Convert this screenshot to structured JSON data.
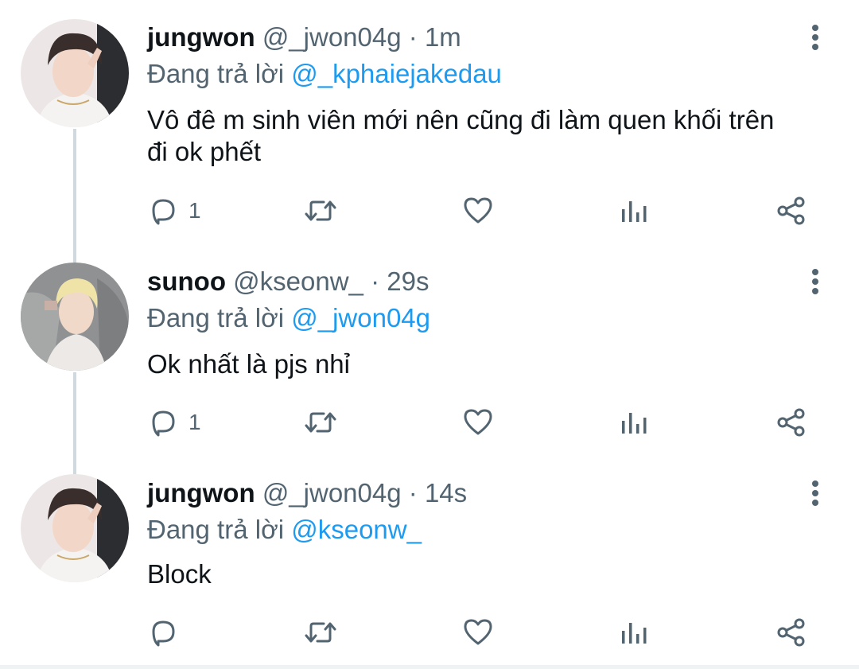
{
  "colors": {
    "text_primary": "#0f1419",
    "text_secondary": "#536471",
    "mention": "#1d9bf0",
    "thread_line": "#cfd9de"
  },
  "tweets": [
    {
      "display_name": "jungwon",
      "handle": "@_jwon04g",
      "separator": "·",
      "time": "1m",
      "reply_prefix": "Đang trả lời",
      "reply_to": "@_kphaiejakedau",
      "text": "Vô đê m sinh viên mới nên cũng đi làm quen khối trên đi ok phết",
      "reply_count": "1",
      "retweet_count": "",
      "like_count": "",
      "icons": [
        "reply-icon",
        "retweet-icon",
        "like-icon",
        "analytics-icon",
        "share-icon",
        "more-icon"
      ]
    },
    {
      "display_name": "sunoo",
      "handle": "@kseonw_",
      "separator": "·",
      "time": "29s",
      "reply_prefix": "Đang trả lời",
      "reply_to": "@_jwon04g",
      "text": "Ok nhất là pjs nhỉ",
      "reply_count": "1",
      "retweet_count": "",
      "like_count": "",
      "icons": [
        "reply-icon",
        "retweet-icon",
        "like-icon",
        "analytics-icon",
        "share-icon",
        "more-icon"
      ]
    },
    {
      "display_name": "jungwon",
      "handle": "@_jwon04g",
      "separator": "·",
      "time": "14s",
      "reply_prefix": "Đang trả lời",
      "reply_to": "@kseonw_",
      "text": "Block",
      "reply_count": "",
      "retweet_count": "",
      "like_count": "",
      "icons": [
        "reply-icon",
        "retweet-icon",
        "like-icon",
        "analytics-icon",
        "share-icon",
        "more-icon"
      ]
    }
  ]
}
